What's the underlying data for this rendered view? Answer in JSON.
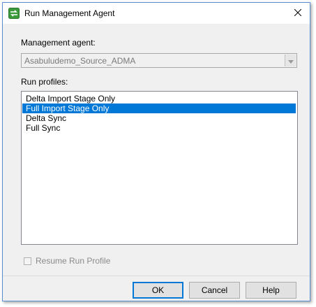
{
  "window": {
    "title": "Run Management Agent",
    "icon": "sync-icon"
  },
  "management_agent": {
    "label": "Management agent:",
    "selected_value": "Asabuludemo_Source_ADMA"
  },
  "run_profiles": {
    "label": "Run profiles:",
    "items": [
      {
        "label": "Delta Import Stage Only",
        "selected": false
      },
      {
        "label": "Full Import Stage Only",
        "selected": true
      },
      {
        "label": "Delta Sync",
        "selected": false
      },
      {
        "label": "Full Sync",
        "selected": false
      }
    ]
  },
  "resume": {
    "label": "Resume Run Profile",
    "checked": false,
    "enabled": false
  },
  "buttons": {
    "ok": "OK",
    "cancel": "Cancel",
    "help": "Help"
  },
  "colors": {
    "selection": "#0078d7",
    "icon_green": "#3c9a3c"
  }
}
